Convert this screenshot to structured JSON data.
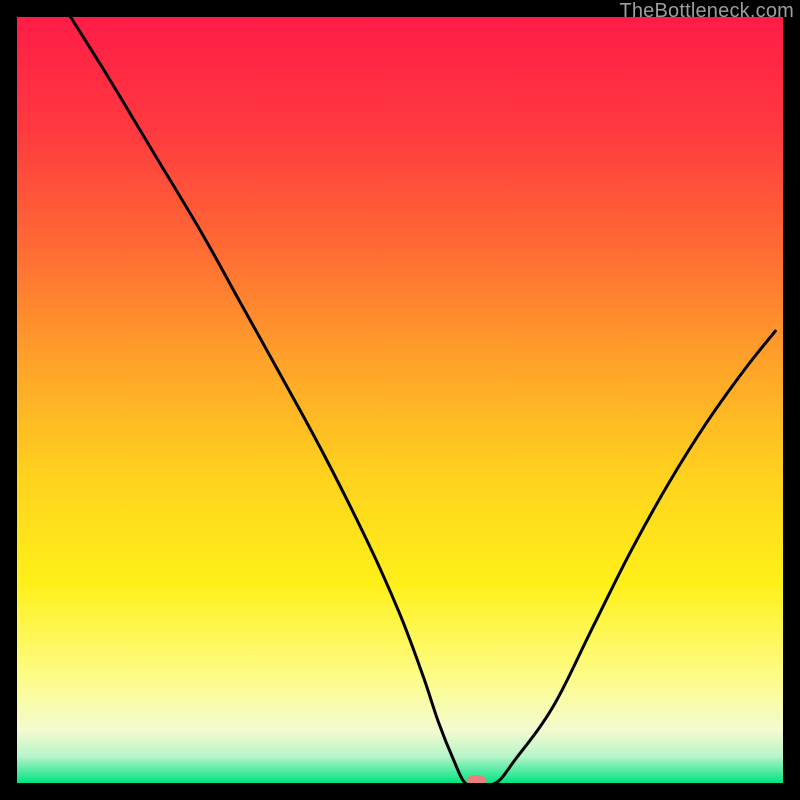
{
  "attribution": "TheBottleneck.com",
  "colors": {
    "accent_marker": "#e98079",
    "curve": "#000000",
    "gradientStops": [
      {
        "offset": 0.0,
        "color": "#ff1c47"
      },
      {
        "offset": 0.15,
        "color": "#ff3a3f"
      },
      {
        "offset": 0.3,
        "color": "#ff6a34"
      },
      {
        "offset": 0.45,
        "color": "#ffa229"
      },
      {
        "offset": 0.6,
        "color": "#ffd21e"
      },
      {
        "offset": 0.74,
        "color": "#fff019"
      },
      {
        "offset": 0.86,
        "color": "#fdfc86"
      },
      {
        "offset": 0.93,
        "color": "#f4fbcf"
      },
      {
        "offset": 0.965,
        "color": "#b7f5c9"
      },
      {
        "offset": 0.985,
        "color": "#4ceba0"
      },
      {
        "offset": 1.0,
        "color": "#00e57e"
      }
    ]
  },
  "chart_data": {
    "type": "line",
    "title": "",
    "xlabel": "",
    "ylabel": "",
    "xlim": [
      0,
      100
    ],
    "ylim": [
      0,
      100
    ],
    "grid": false,
    "legend": false,
    "series": [
      {
        "name": "bottleneck-curve",
        "x": [
          7,
          12,
          18,
          24,
          29,
          34,
          40,
          46,
          50,
          53,
          55,
          57,
          58.5,
          60,
          62.5,
          65,
          70,
          75,
          80,
          85,
          90,
          95,
          99
        ],
        "y": [
          100,
          92,
          82,
          72,
          63,
          54,
          43,
          31,
          22,
          14,
          8,
          3,
          0,
          0,
          0,
          3,
          10,
          20,
          30,
          39,
          47,
          54,
          59
        ]
      }
    ],
    "marker": {
      "x": 60,
      "y": 0,
      "color": "#e98079",
      "rx": 10,
      "ry": 5
    }
  }
}
